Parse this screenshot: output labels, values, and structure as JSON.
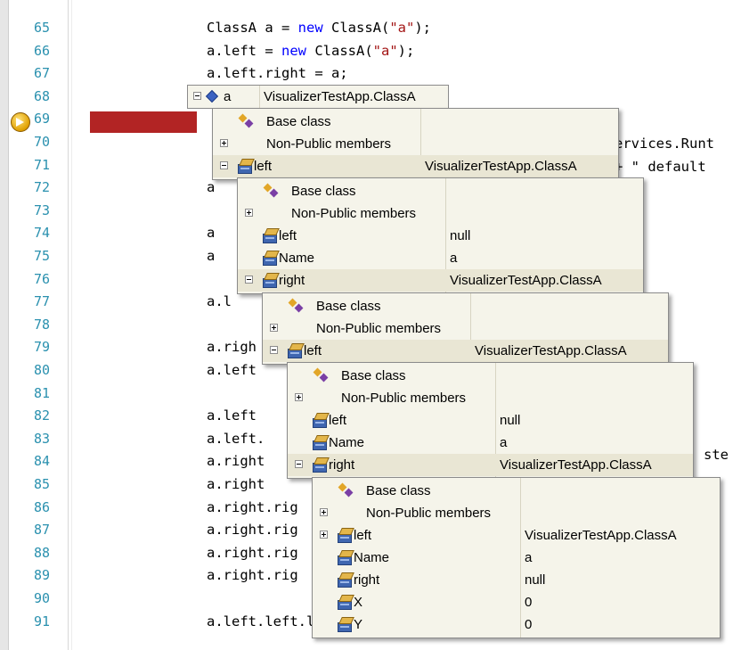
{
  "editor": {
    "lines": [
      {
        "num": "65",
        "code": [
          {
            "t": "ClassA a = ",
            "c": "plain"
          },
          {
            "t": "new",
            "c": "kw"
          },
          {
            "t": " ClassA(",
            "c": "plain"
          },
          {
            "t": "\"a\"",
            "c": "str"
          },
          {
            "t": ");",
            "c": "plain"
          }
        ]
      },
      {
        "num": "66",
        "code": [
          {
            "t": "a.left = ",
            "c": "plain"
          },
          {
            "t": "new",
            "c": "kw"
          },
          {
            "t": " ClassA(",
            "c": "plain"
          },
          {
            "t": "\"a\"",
            "c": "str"
          },
          {
            "t": ");",
            "c": "plain"
          }
        ]
      },
      {
        "num": "67",
        "code": [
          {
            "t": "a.left.right = a;",
            "c": "plain"
          }
        ]
      },
      {
        "num": "68",
        "code": []
      },
      {
        "num": "69",
        "code": []
      },
      {
        "num": "70",
        "code": []
      },
      {
        "num": "71",
        "code": []
      },
      {
        "num": "72",
        "code": [
          {
            "t": "a",
            "c": "plain"
          }
        ]
      },
      {
        "num": "73",
        "code": []
      },
      {
        "num": "74",
        "code": [
          {
            "t": "a",
            "c": "plain"
          }
        ]
      },
      {
        "num": "75",
        "code": [
          {
            "t": "a",
            "c": "plain"
          }
        ]
      },
      {
        "num": "76",
        "code": []
      },
      {
        "num": "77",
        "code": [
          {
            "t": "a.l",
            "c": "plain"
          }
        ]
      },
      {
        "num": "78",
        "code": []
      },
      {
        "num": "79",
        "code": [
          {
            "t": "a.righ",
            "c": "plain"
          }
        ]
      },
      {
        "num": "80",
        "code": [
          {
            "t": "a.left",
            "c": "plain"
          }
        ]
      },
      {
        "num": "81",
        "code": []
      },
      {
        "num": "82",
        "code": [
          {
            "t": "a.left",
            "c": "plain"
          }
        ]
      },
      {
        "num": "83",
        "code": [
          {
            "t": "a.left.",
            "c": "plain"
          }
        ]
      },
      {
        "num": "84",
        "code": [
          {
            "t": "a.right",
            "c": "plain"
          }
        ]
      },
      {
        "num": "85",
        "code": [
          {
            "t": "a.right",
            "c": "plain"
          }
        ]
      },
      {
        "num": "86",
        "code": [
          {
            "t": "a.right.rig",
            "c": "plain"
          }
        ]
      },
      {
        "num": "87",
        "code": [
          {
            "t": "a.right.rig",
            "c": "plain"
          }
        ]
      },
      {
        "num": "88",
        "code": [
          {
            "t": "a.right.rig",
            "c": "plain"
          }
        ]
      },
      {
        "num": "89",
        "code": [
          {
            "t": "a.right.rig",
            "c": "plain"
          }
        ]
      },
      {
        "num": "90",
        "code": []
      },
      {
        "num": "91",
        "code": [
          {
            "t": "a.left.left.left.right = a;",
            "c": "plain"
          }
        ]
      }
    ],
    "right_fragments": {
      "line70": "ervices.Runt",
      "line71": "+ \" default",
      "line83": "ste"
    },
    "colors": {
      "line_number": "#2b91af",
      "keyword": "#0000ff",
      "string": "#a31515",
      "breakpoint_bar": "#b22424",
      "tooltip_bg": "#f5f4ea"
    }
  },
  "datatip": {
    "root": {
      "name": "a",
      "value": "VisualizerTestApp.ClassA"
    },
    "levels": [
      {
        "rows": [
          {
            "icon": "base-class",
            "name": "Base class",
            "value": ""
          },
          {
            "icon": "none",
            "expander": "plus",
            "name": "Non-Public members",
            "value": ""
          },
          {
            "icon": "field",
            "expander": "minus",
            "name": "left",
            "value": "VisualizerTestApp.ClassA"
          }
        ]
      },
      {
        "rows": [
          {
            "icon": "base-class",
            "name": "Base class",
            "value": ""
          },
          {
            "icon": "none",
            "expander": "plus",
            "name": "Non-Public members",
            "value": ""
          },
          {
            "icon": "field",
            "name": "left",
            "value": "null"
          },
          {
            "icon": "field",
            "name": "Name",
            "value": "a"
          },
          {
            "icon": "field",
            "expander": "minus",
            "name": "right",
            "value": "VisualizerTestApp.ClassA"
          }
        ]
      },
      {
        "rows": [
          {
            "icon": "base-class",
            "name": "Base class",
            "value": ""
          },
          {
            "icon": "none",
            "expander": "plus",
            "name": "Non-Public members",
            "value": ""
          },
          {
            "icon": "field",
            "expander": "minus",
            "name": "left",
            "value": "VisualizerTestApp.ClassA"
          }
        ]
      },
      {
        "rows": [
          {
            "icon": "base-class",
            "name": "Base class",
            "value": ""
          },
          {
            "icon": "none",
            "expander": "plus",
            "name": "Non-Public members",
            "value": ""
          },
          {
            "icon": "field",
            "name": "left",
            "value": "null"
          },
          {
            "icon": "field",
            "name": "Name",
            "value": "a"
          },
          {
            "icon": "field",
            "expander": "minus",
            "name": "right",
            "value": "VisualizerTestApp.ClassA"
          }
        ]
      },
      {
        "rows": [
          {
            "icon": "base-class",
            "name": "Base class",
            "value": ""
          },
          {
            "icon": "none",
            "expander": "plus",
            "name": "Non-Public members",
            "value": ""
          },
          {
            "icon": "field",
            "expander": "plus",
            "name": "left",
            "value": "VisualizerTestApp.ClassA"
          },
          {
            "icon": "field",
            "name": "Name",
            "value": "a"
          },
          {
            "icon": "field",
            "name": "right",
            "value": "null"
          },
          {
            "icon": "field",
            "name": "X",
            "value": "0"
          },
          {
            "icon": "field",
            "name": "Y",
            "value": "0"
          }
        ]
      }
    ]
  }
}
